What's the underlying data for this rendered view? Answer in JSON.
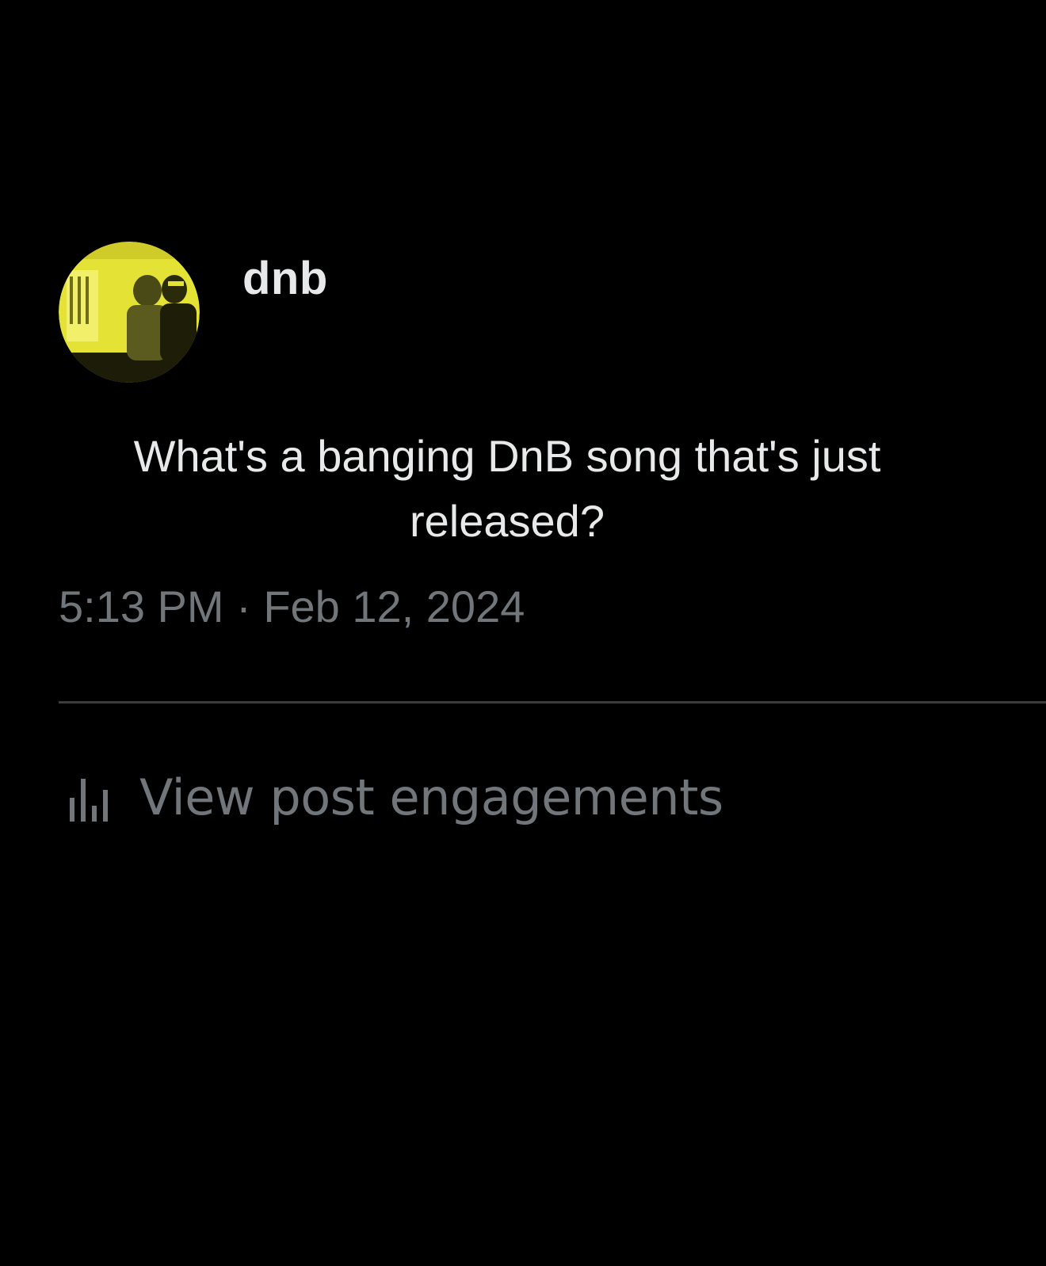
{
  "post": {
    "author": {
      "display_name": "dnb",
      "avatar_icon": "profile-photo-yellow-tint"
    },
    "text_line1": "What's a banging DnB song that's just",
    "text_line2": "released?",
    "timestamp": "5:13 PM · Feb 12, 2024",
    "engagements": {
      "icon": "bar-chart-icon",
      "label": "View post engagements"
    }
  },
  "colors": {
    "background": "#000000",
    "primary_text": "#e7e9ea",
    "secondary_text": "#71767b",
    "divider": "#3a3d40",
    "avatar_tint": "#e5e236"
  }
}
